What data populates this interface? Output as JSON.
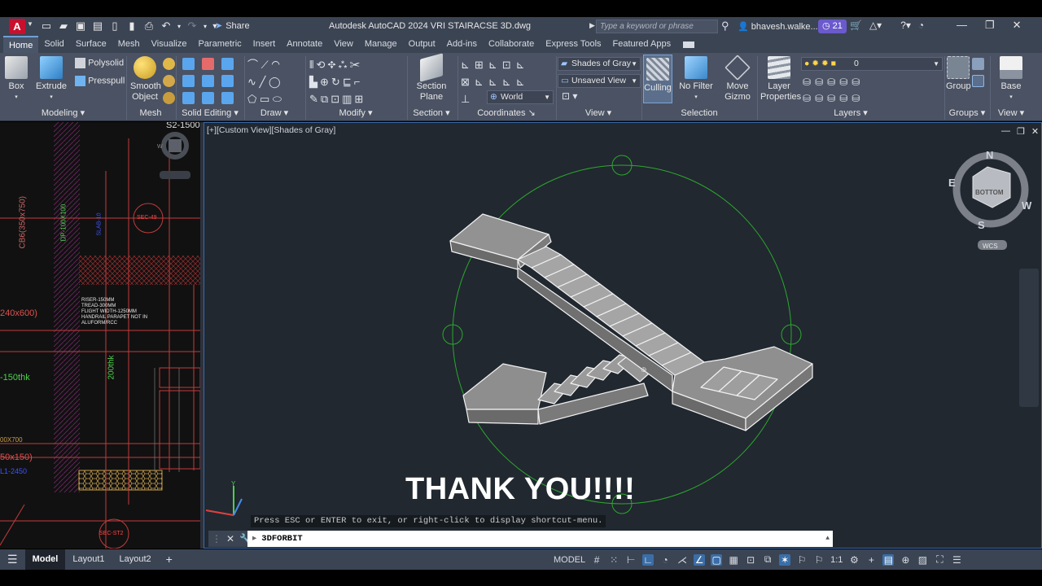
{
  "titlebar": {
    "logo": "A",
    "share_label": "Share",
    "title": "Autodesk AutoCAD 2024    VRI STAIRACSE 3D.dwg",
    "search_placeholder": "Type a keyword or phrase",
    "user": "bhavesh.walke...",
    "badge_count": "21"
  },
  "tabs": [
    "Home",
    "Solid",
    "Surface",
    "Mesh",
    "Visualize",
    "Parametric",
    "Insert",
    "Annotate",
    "View",
    "Manage",
    "Output",
    "Add-ins",
    "Collaborate",
    "Express Tools",
    "Featured Apps"
  ],
  "active_tab": "Home",
  "ribbon": {
    "box": "Box",
    "extrude": "Extrude",
    "polysolid": "Polysolid",
    "presspull": "Presspull",
    "smooth_object_1": "Smooth",
    "smooth_object_2": "Object",
    "section_plane_1": "Section",
    "section_plane_2": "Plane",
    "culling": "Culling",
    "no_filter": "No Filter",
    "move_gizmo_1": "Move",
    "move_gizmo_2": "Gizmo",
    "layer_props_1": "Layer",
    "layer_props_2": "Properties",
    "group": "Group",
    "base": "Base",
    "visual_style": "Shades of Gray",
    "view_state": "Unsaved View",
    "coords": "World",
    "layer_value": "0",
    "panels": {
      "modeling": "Modeling",
      "mesh": "Mesh",
      "solid_editing": "Solid Editing",
      "draw": "Draw",
      "modify": "Modify",
      "section": "Section",
      "coordinates": "Coordinates",
      "view": "View",
      "selection": "Selection",
      "layers": "Layers",
      "groups": "Groups",
      "view2": "View"
    }
  },
  "viewport": {
    "label": "[+][Custom View][Shades of Gray]",
    "overlay_text": "THANK YOU!!!!",
    "hint": "Press ESC or ENTER to exit, or right-click to display shortcut-menu.",
    "viewcube_face": "BOTTOM",
    "compass": {
      "n": "N",
      "e": "E",
      "s": "S",
      "w": "W"
    },
    "wcs": "WCS",
    "ucs_y": "Y"
  },
  "left_drawing": {
    "labels": {
      "s2": "S2-1500",
      "cb6": "CB6(350x750)",
      "dp": "DP-100X100",
      "sec49": "SEC-49",
      "notes": [
        "RISER-150MM",
        "TREAD-300MM",
        "FLIGHT WIDTH-1250MM",
        "HANDRAIL PARAPET NOT IN",
        "ALUFORM/RCC"
      ],
      "dim_240": "240x600)",
      "thk150": "-150thk",
      "thk200": "200thk",
      "dim_00x700": "00X700",
      "dim_50x150": "50x150)",
      "sec_st2": "SEC-ST2",
      "blue_1": "SLAB-10",
      "blue_2": "L1-2450"
    }
  },
  "command": {
    "prefix": "▸",
    "text": "3DFORBIT"
  },
  "statusbar": {
    "tabs": [
      "Model",
      "Layout1",
      "Layout2"
    ],
    "active": "Model",
    "model_label": "MODEL",
    "scale": "1:1"
  }
}
